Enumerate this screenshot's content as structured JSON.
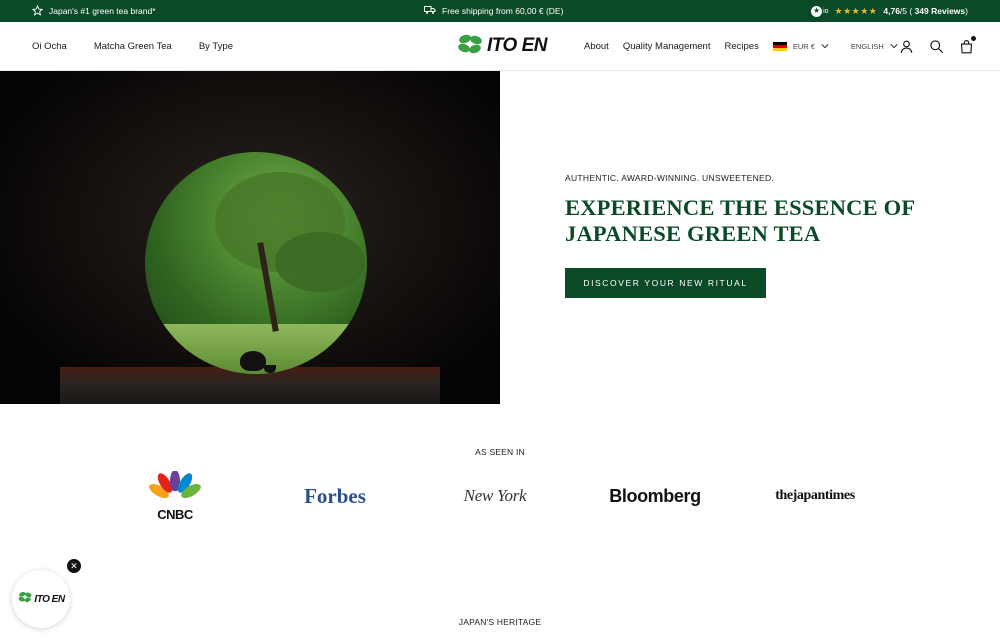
{
  "announcement": {
    "left_text": "Japan's #1 green tea brand*",
    "center_text": "Free shipping from 60,00 € (DE)",
    "reviews": {
      "badge_mark": "★",
      "badge_label": "io",
      "stars": "★★★★★",
      "score": "4,76",
      "max": "/5",
      "open_paren": " ( ",
      "count": "349 Reviews",
      "close_paren": ")"
    }
  },
  "header": {
    "nav_left": [
      "Oi Ocha",
      "Matcha Green Tea",
      "By Type"
    ],
    "logo_text": "ITO EN",
    "nav_right": [
      "About",
      "Quality Management",
      "Recipes"
    ],
    "currency": "EUR €",
    "language": "ENGLISH",
    "icons": [
      "account-icon",
      "search-icon",
      "cart-icon"
    ]
  },
  "hero": {
    "eyebrow": "AUTHENTIC. AWARD-WINNING. UNSWEETENED.",
    "headline_line1": "EXPERIENCE THE ESSENCE OF",
    "headline_line2": "JAPANESE GREEN TEA",
    "cta": "DISCOVER YOUR NEW RITUAL"
  },
  "press": {
    "title": "AS SEEN IN",
    "logos": {
      "cnbc": "CNBC",
      "forbes": "Forbes",
      "newyork": "New York",
      "bloomberg": "Bloomberg",
      "japantimes": "thejapantimes"
    }
  },
  "heritage": {
    "title": "JAPAN'S HERITAGE"
  },
  "floating": {
    "logo_text": "ITO EN",
    "close_label": "✕"
  },
  "colors": {
    "brand_green": "#0b4a26",
    "leaf_green": "#3aa043",
    "star_gold": "#e8b92e"
  }
}
